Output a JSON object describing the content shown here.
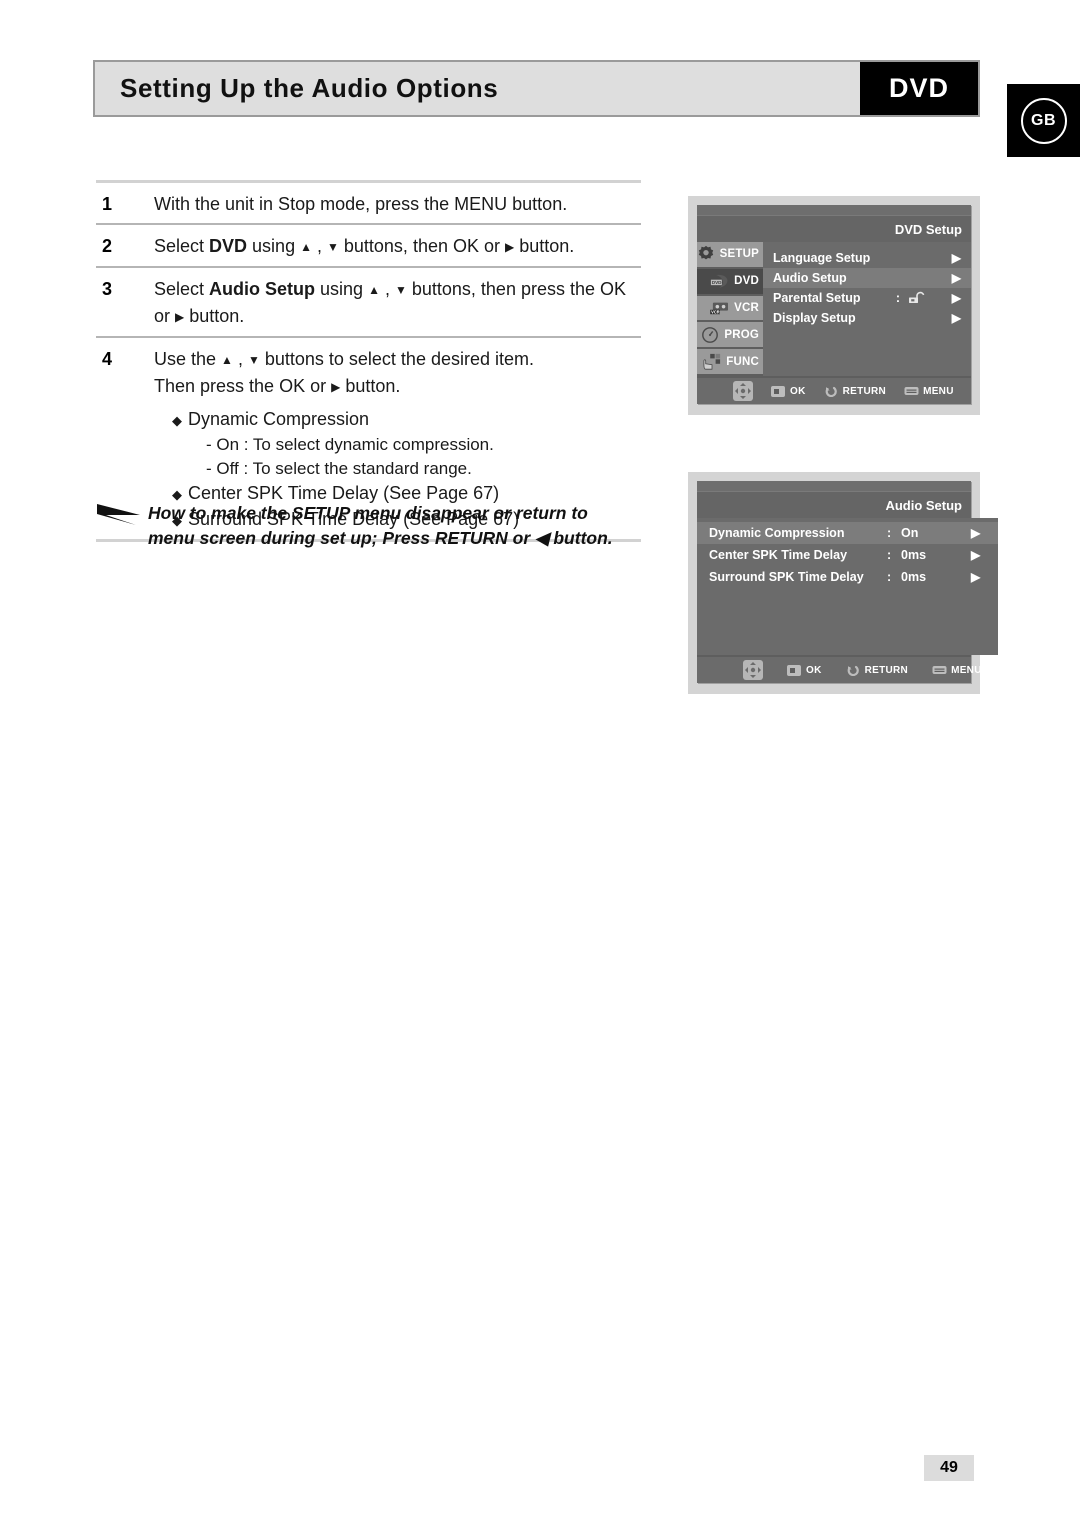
{
  "header": {
    "title": "Setting Up the Audio Options",
    "badge": "DVD",
    "region": "GB"
  },
  "steps": [
    {
      "num": "1",
      "text_parts": [
        {
          "t": "With the unit in Stop mode, press the MENU button.",
          "bold": false
        }
      ]
    },
    {
      "num": "2",
      "text_parts": [
        {
          "t": "Select ",
          "bold": false
        },
        {
          "t": "DVD",
          "bold": true
        },
        {
          "t": " using ",
          "bold": false
        },
        {
          "t": "▲",
          "bold": false,
          "glyph": true
        },
        {
          "t": " , ",
          "bold": false
        },
        {
          "t": "▼",
          "bold": false,
          "glyph": true
        },
        {
          "t": " buttons, then OK or ",
          "bold": false
        },
        {
          "t": "▶",
          "bold": false,
          "glyph": true
        },
        {
          "t": " button.",
          "bold": false
        }
      ]
    },
    {
      "num": "3",
      "text_parts": [
        {
          "t": "Select ",
          "bold": false
        },
        {
          "t": "Audio Setup",
          "bold": true
        },
        {
          "t": " using ",
          "bold": false
        },
        {
          "t": "▲",
          "bold": false,
          "glyph": true
        },
        {
          "t": " , ",
          "bold": false
        },
        {
          "t": "▼",
          "bold": false,
          "glyph": true
        },
        {
          "t": " buttons, then press the OK or ",
          "bold": false
        },
        {
          "t": "▶",
          "bold": false,
          "glyph": true
        },
        {
          "t": " button.",
          "bold": false
        }
      ]
    },
    {
      "num": "4",
      "text_parts": [
        {
          "t": "Use the ",
          "bold": false
        },
        {
          "t": "▲",
          "bold": false,
          "glyph": true
        },
        {
          "t": " , ",
          "bold": false
        },
        {
          "t": "▼",
          "bold": false,
          "glyph": true
        },
        {
          "t": " buttons to select the desired item.",
          "bold": false
        },
        {
          "t": "\n",
          "bold": false
        },
        {
          "t": "Then press the OK or ",
          "bold": false
        },
        {
          "t": "▶",
          "bold": false,
          "glyph": true
        },
        {
          "t": " button.",
          "bold": false
        }
      ],
      "bullets": [
        {
          "label": "Dynamic Compression",
          "subs": [
            "- On : To select dynamic compression.",
            "- Off : To select the standard range."
          ]
        },
        {
          "label": "Center SPK Time Delay (See Page 67)",
          "subs": []
        },
        {
          "label": "Surround SPK Time Delay (See Page 67)",
          "subs": []
        }
      ]
    }
  ],
  "note": {
    "line1": "How to make the SETUP menu disappear or return to",
    "line2_a": "menu screen during set up; Press RETURN or ",
    "line2_glyph": "◀",
    "line2_b": " button."
  },
  "osd_dvd_setup": {
    "title": "DVD Setup",
    "sidebar": [
      {
        "label": "SETUP",
        "icon": "gear-icon",
        "selected": false
      },
      {
        "label": "DVD",
        "icon": "disc-icon",
        "selected": true
      },
      {
        "label": "VCR",
        "icon": "cassette-icon",
        "selected": false
      },
      {
        "label": "PROG",
        "icon": "clock-icon",
        "selected": false
      },
      {
        "label": "FUNC",
        "icon": "hand-blocks-icon",
        "selected": false
      }
    ],
    "rows": [
      {
        "label": "Language Setup",
        "colon": "",
        "value": "",
        "arrow": "▶",
        "highlighted": false
      },
      {
        "label": "Audio Setup",
        "colon": "",
        "value": "",
        "arrow": "▶",
        "highlighted": true
      },
      {
        "label": "Parental Setup",
        "colon": ":",
        "value": "lock",
        "arrow": "▶",
        "highlighted": false
      },
      {
        "label": "Display Setup",
        "colon": "",
        "value": "",
        "arrow": "▶",
        "highlighted": false
      }
    ],
    "bottom": [
      {
        "label": "",
        "icon": "dpad-icon"
      },
      {
        "label": "OK",
        "icon": "ok-button-icon"
      },
      {
        "label": "RETURN",
        "icon": "return-button-icon"
      },
      {
        "label": "MENU",
        "icon": "menu-button-icon"
      }
    ]
  },
  "osd_audio_setup": {
    "title": "Audio Setup",
    "rows": [
      {
        "label": "Dynamic Compression",
        "colon": ":",
        "value": "On",
        "arrow": "▶",
        "highlighted": true
      },
      {
        "label": "Center SPK Time Delay",
        "colon": ":",
        "value": "0ms",
        "arrow": "▶",
        "highlighted": false
      },
      {
        "label": "Surround SPK Time Delay",
        "colon": ":",
        "value": "0ms",
        "arrow": "▶",
        "highlighted": false
      }
    ],
    "bottom": [
      {
        "label": "",
        "icon": "dpad-icon"
      },
      {
        "label": "OK",
        "icon": "ok-button-icon"
      },
      {
        "label": "RETURN",
        "icon": "return-button-icon"
      },
      {
        "label": "MENU",
        "icon": "menu-button-icon"
      }
    ]
  },
  "page_number": "49",
  "colors": {
    "header_bg": "#dedede",
    "header_border": "#9a9a9a",
    "badge_bg": "#000000",
    "osd_frame": "#d4d4d4",
    "osd_bg": "#5e5e5e",
    "osd_panel": "#6b6b6b",
    "osd_highlight": "#7c7c7c",
    "rule": "#c9c9c9"
  }
}
